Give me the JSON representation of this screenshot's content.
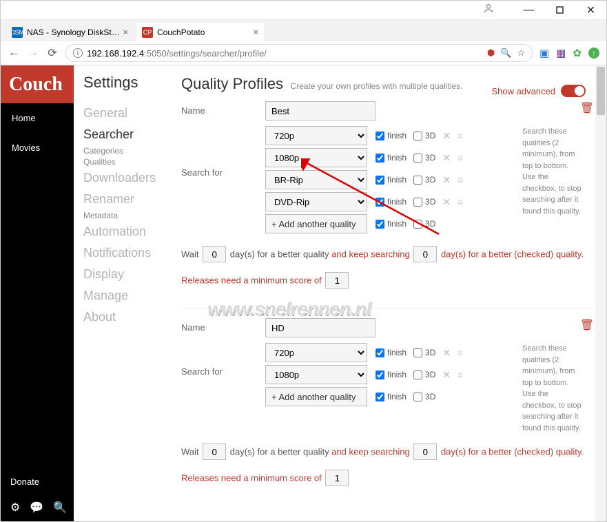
{
  "window": {
    "tabs": [
      {
        "title": "NAS - Synology DiskStat...",
        "active": false
      },
      {
        "title": "CouchPotato",
        "active": true
      }
    ],
    "url_host": "192.168.192.4",
    "url_port_path": ":5050/settings/searcher/profile/"
  },
  "sidebar": {
    "logo": "Couch",
    "items": [
      "Home",
      "Movies"
    ],
    "donate": "Donate"
  },
  "settings_nav": {
    "title": "Settings",
    "items": [
      {
        "label": "General"
      },
      {
        "label": "Searcher",
        "active": true,
        "sub": [
          "Categories",
          "Qualities"
        ]
      },
      {
        "label": "Downloaders"
      },
      {
        "label": "Renamer",
        "sub": [
          "Metadata"
        ]
      },
      {
        "label": "Automation"
      },
      {
        "label": "Notifications"
      },
      {
        "label": "Display"
      },
      {
        "label": "Manage"
      },
      {
        "label": "About"
      }
    ]
  },
  "header": {
    "show_advanced": "Show advanced"
  },
  "page": {
    "title": "Quality Profiles",
    "subtitle": "Create your own profiles with multiple qualities.",
    "labels": {
      "name": "Name",
      "search_for": "Search for",
      "finish": "finish",
      "threeD": "3D",
      "add_another": "+ Add another quality",
      "wait": "Wait",
      "days_better": "day(s) for a better quality",
      "keep_searching": "and keep searching",
      "days_checked": "day(s) for a better (checked) quality.",
      "min_score": "Releases need a minimum score of",
      "help": "Search these qualities (2 minimum), from top to bottom. Use the checkbox, to stop searching after it found this quality."
    },
    "profiles": [
      {
        "name": "Best",
        "qualities": [
          {
            "q": "720p",
            "finish": true,
            "threeD": false,
            "removable": true
          },
          {
            "q": "1080p",
            "finish": true,
            "threeD": false,
            "removable": true
          },
          {
            "q": "BR-Rip",
            "finish": true,
            "threeD": false,
            "removable": true
          },
          {
            "q": "DVD-Rip",
            "finish": true,
            "threeD": false,
            "removable": true
          }
        ],
        "wait_days": "0",
        "keep_days": "0",
        "min_score": "1"
      },
      {
        "name": "HD",
        "qualities": [
          {
            "q": "720p",
            "finish": true,
            "threeD": false,
            "removable": true
          },
          {
            "q": "1080p",
            "finish": true,
            "threeD": false,
            "removable": true
          }
        ],
        "wait_days": "0",
        "keep_days": "0",
        "min_score": "1"
      }
    ]
  },
  "watermark": "www.snelrennen.nl"
}
